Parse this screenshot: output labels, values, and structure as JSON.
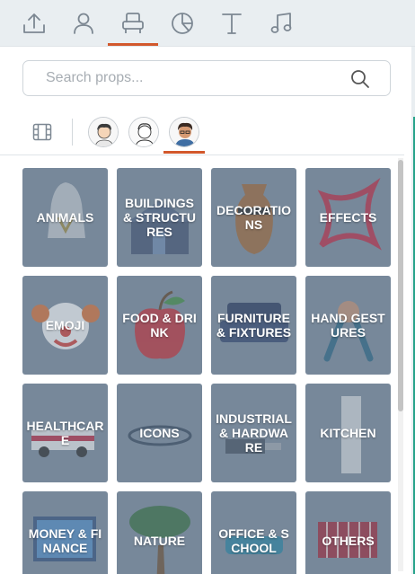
{
  "tabs": [
    {
      "icon": "upload-icon"
    },
    {
      "icon": "character-icon"
    },
    {
      "icon": "props-chair-icon",
      "active": true
    },
    {
      "icon": "chart-icon"
    },
    {
      "icon": "text-icon"
    },
    {
      "icon": "music-icon"
    }
  ],
  "search": {
    "placeholder": "Search props..."
  },
  "characters": [
    {
      "icon": "avatar-character-1"
    },
    {
      "icon": "avatar-character-2"
    },
    {
      "icon": "avatar-character-3",
      "active": true
    }
  ],
  "categories": [
    "ANIMALS",
    "BUILDINGS & STRUCTURES",
    "DECORATIONS",
    "EFFECTS",
    "EMOJI",
    "FOOD & DRINK",
    "FURNITURE & FIXTURES",
    "HAND GESTURES",
    "HEALTHCARE",
    "ICONS",
    "INDUSTRIAL & HARDWARE",
    "KITCHEN",
    "MONEY & FINANCE",
    "NATURE",
    "OFFICE & SCHOOL",
    "OTHERS"
  ],
  "colors": {
    "accent": "#d2582c",
    "tile": "#77889a",
    "tabbar": "#e9eef1"
  }
}
